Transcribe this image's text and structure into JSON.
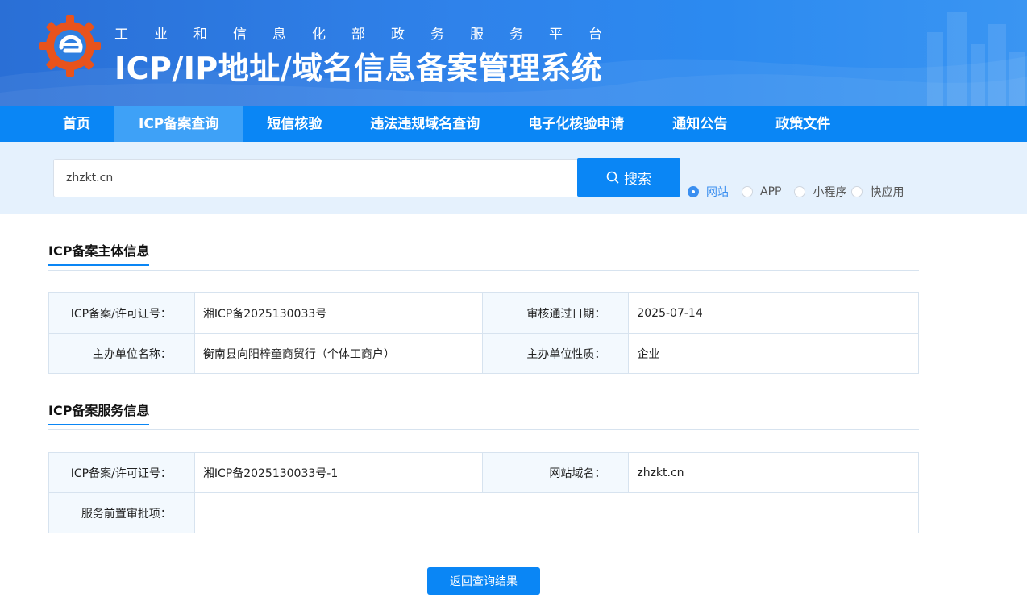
{
  "header": {
    "subtitle": "工业和信息化部政务服务平台",
    "title": "ICP/IP地址/域名信息备案管理系统"
  },
  "nav": {
    "items": [
      {
        "label": "首页"
      },
      {
        "label": "ICP备案查询"
      },
      {
        "label": "短信核验"
      },
      {
        "label": "违法违规域名查询"
      },
      {
        "label": "电子化核验申请"
      },
      {
        "label": "通知公告"
      },
      {
        "label": "政策文件"
      }
    ],
    "active_index": 1
  },
  "search": {
    "value": "zhzkt.cn",
    "button_label": "搜索",
    "options": [
      {
        "label": "网站",
        "checked": true
      },
      {
        "label": "APP",
        "checked": false
      },
      {
        "label": "小程序",
        "checked": false
      },
      {
        "label": "快应用",
        "checked": false
      }
    ]
  },
  "entity_section": {
    "title": "ICP备案主体信息",
    "rows": [
      {
        "k1": "ICP备案/许可证号：",
        "v1": "湘ICP备2025130033号",
        "k2": "审核通过日期：",
        "v2": "2025-07-14"
      },
      {
        "k1": "主办单位名称：",
        "v1": "衡南县向阳梓童商贸行（个体工商户）",
        "k2": "主办单位性质：",
        "v2": "企业"
      }
    ]
  },
  "service_section": {
    "title": "ICP备案服务信息",
    "rows": [
      {
        "k1": "ICP备案/许可证号：",
        "v1": "湘ICP备2025130033号-1",
        "k2": "网站域名：",
        "v2": "zhzkt.cn"
      },
      {
        "k1": "服务前置审批项：",
        "v1": ""
      }
    ]
  },
  "back_button_label": "返回查询结果",
  "colors": {
    "primary": "#0a86f5",
    "nav_active": "#3ea1f7",
    "search_band": "#e5f1fd",
    "table_key_bg": "#f3f9fe",
    "border": "#d7e3ef"
  }
}
